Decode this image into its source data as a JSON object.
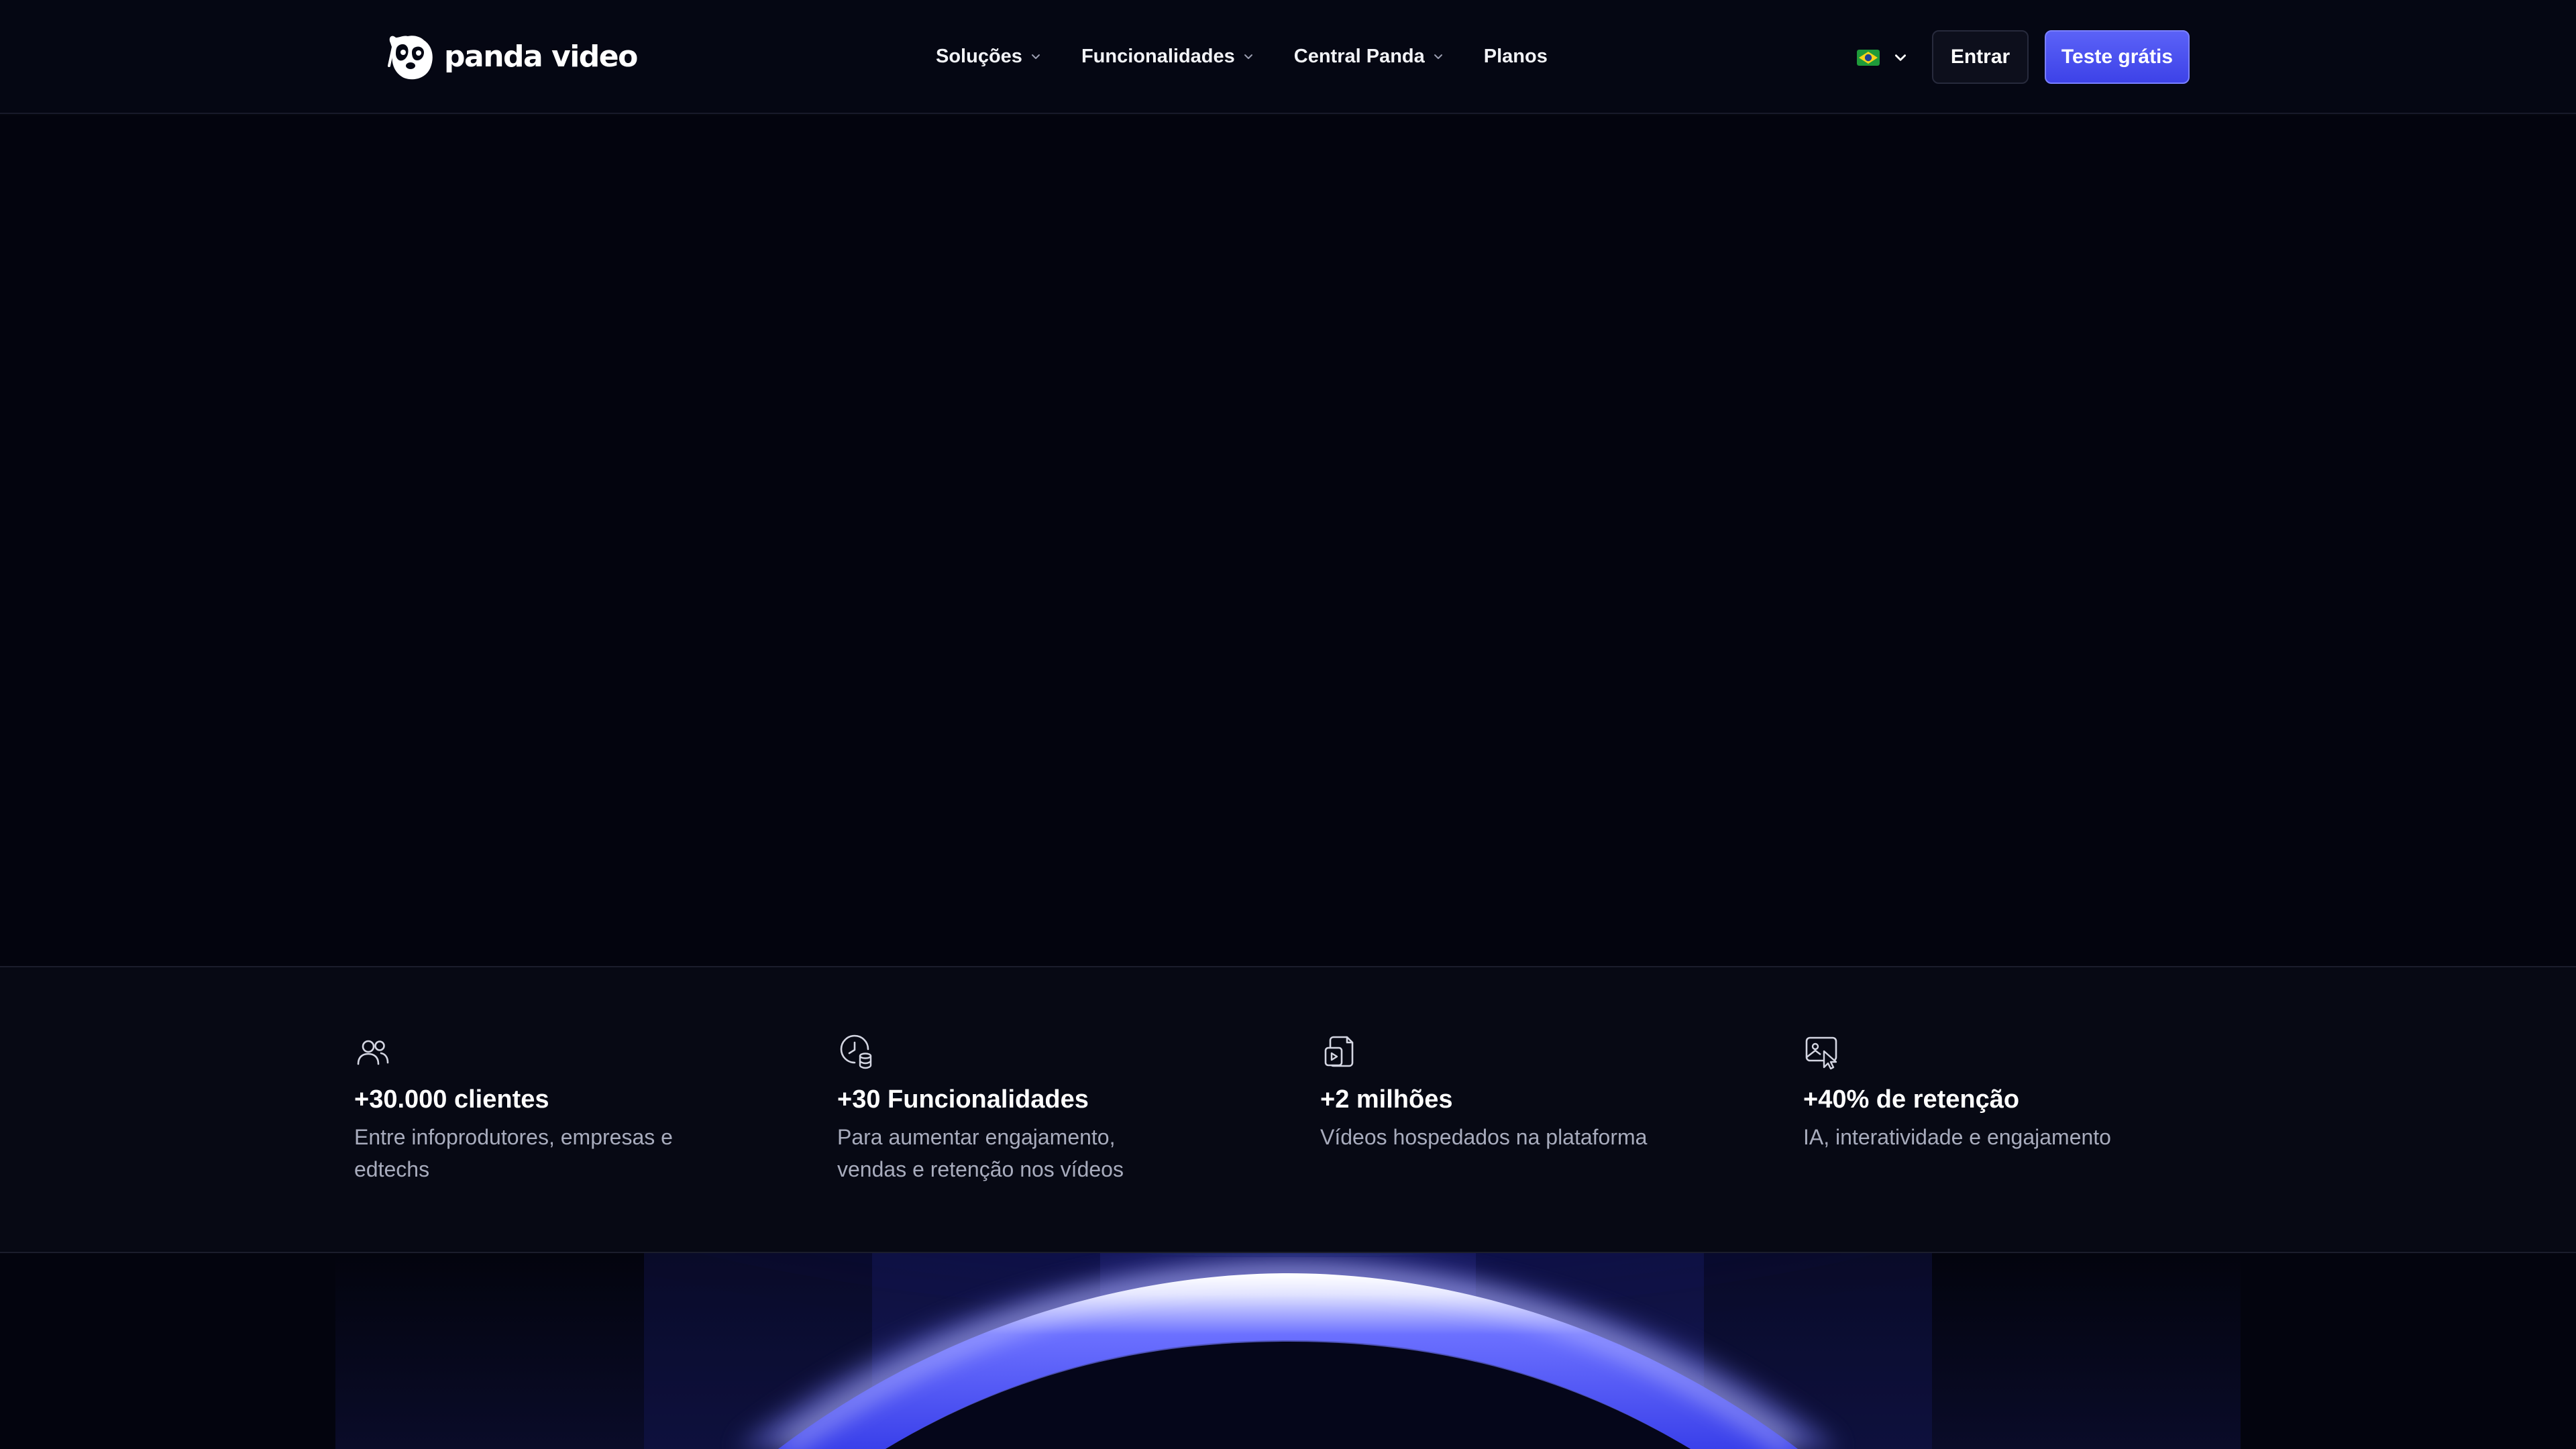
{
  "brand": {
    "name": "panda video"
  },
  "nav": {
    "items": [
      {
        "label": "Soluções",
        "has_dropdown": true
      },
      {
        "label": "Funcionalidades",
        "has_dropdown": true
      },
      {
        "label": "Central Panda",
        "has_dropdown": true
      },
      {
        "label": "Planos",
        "has_dropdown": false
      }
    ],
    "language_icon": "brazil-flag-icon",
    "login_label": "Entrar",
    "cta_label": "Teste grátis"
  },
  "stats": [
    {
      "icon": "users-icon",
      "title": "+30.000 clientes",
      "description": "Entre infoprodutores, empresas e edtechs"
    },
    {
      "icon": "clock-database-icon",
      "title": "+30 Funcionalidades",
      "description": "Para aumentar engajamento, vendas e retenção nos vídeos"
    },
    {
      "icon": "video-file-icon",
      "title": "+2 milhões",
      "description": "Vídeos hospedados na plataforma"
    },
    {
      "icon": "image-cursor-icon",
      "title": "+40% de retenção",
      "description": "IA, interatividade e engajamento"
    }
  ],
  "colors": {
    "background": "#03040e",
    "navbar": "#050713",
    "accent": "#4048ee",
    "stats_background": "#070914",
    "muted_text": "#a8acbd"
  }
}
